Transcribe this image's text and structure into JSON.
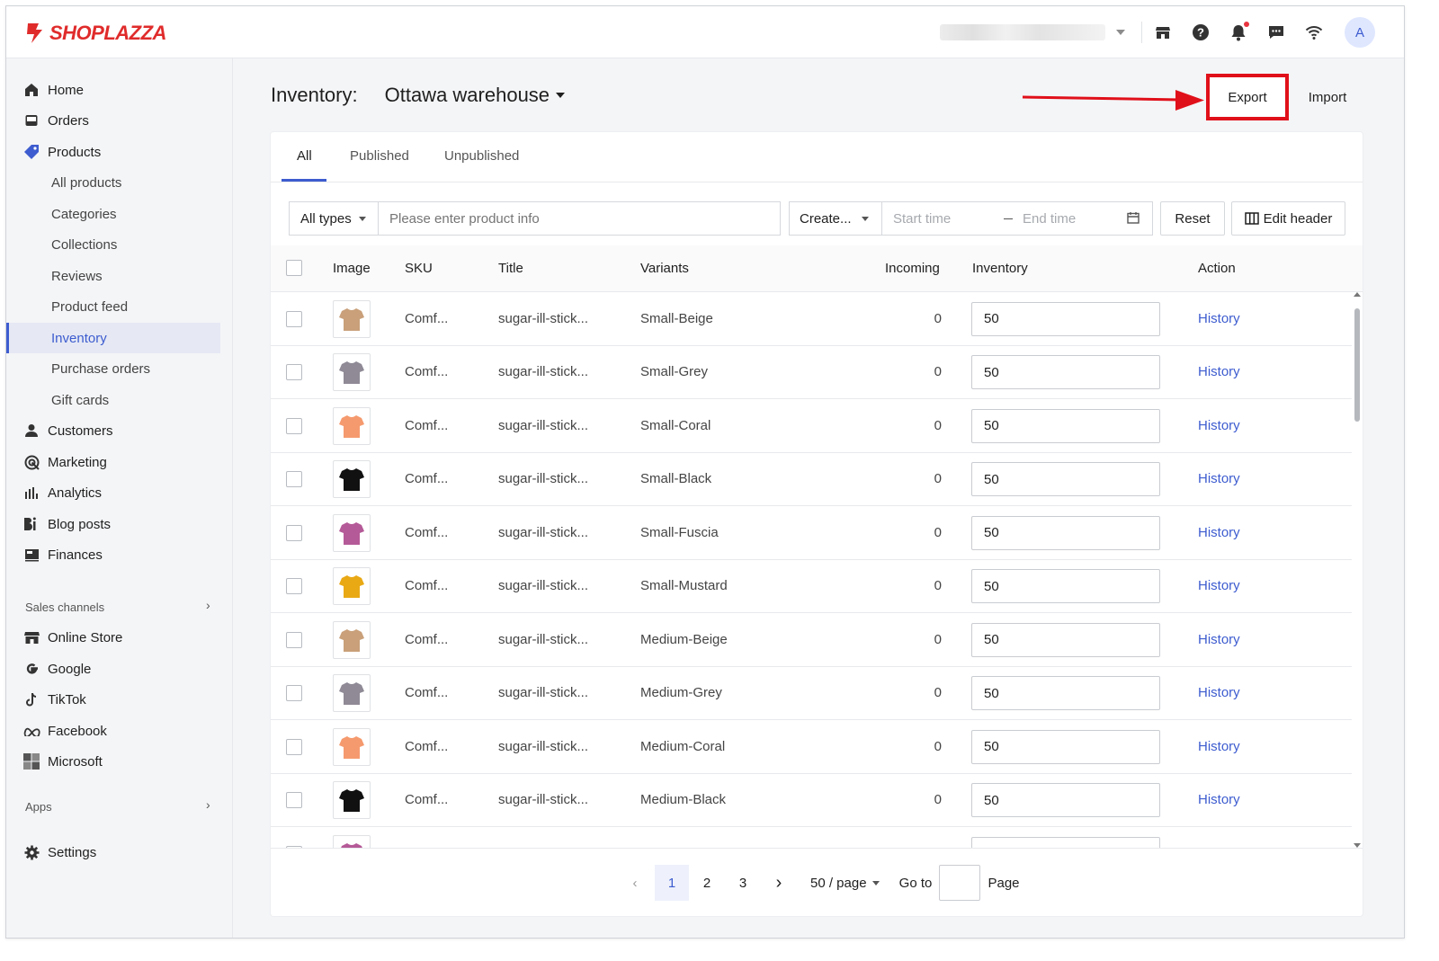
{
  "app": {
    "logo_text": "SHOPLAZZA",
    "avatar_initial": "A"
  },
  "topbar": {
    "icons": [
      "store-icon",
      "help-icon",
      "bell-icon",
      "chat-icon",
      "wifi-icon"
    ]
  },
  "sidebar": {
    "items": [
      {
        "label": "Home",
        "icon": "home-icon"
      },
      {
        "label": "Orders",
        "icon": "orders-icon"
      },
      {
        "label": "Products",
        "icon": "tag-icon"
      },
      {
        "label": "All products"
      },
      {
        "label": "Categories"
      },
      {
        "label": "Collections"
      },
      {
        "label": "Reviews"
      },
      {
        "label": "Product feed"
      },
      {
        "label": "Inventory",
        "active": true
      },
      {
        "label": "Purchase orders"
      },
      {
        "label": "Gift cards"
      },
      {
        "label": "Customers",
        "icon": "person-icon"
      },
      {
        "label": "Marketing",
        "icon": "marketing-icon"
      },
      {
        "label": "Analytics",
        "icon": "analytics-icon"
      },
      {
        "label": "Blog posts",
        "icon": "blog-icon"
      },
      {
        "label": "Finances",
        "icon": "finances-icon"
      }
    ],
    "sales_channels_label": "Sales channels",
    "channels": [
      {
        "label": "Online Store",
        "icon": "storefront-icon"
      },
      {
        "label": "Google",
        "icon": "google-icon"
      },
      {
        "label": "TikTok",
        "icon": "tiktok-icon"
      },
      {
        "label": "Facebook",
        "icon": "meta-icon"
      },
      {
        "label": "Microsoft",
        "icon": "microsoft-icon"
      }
    ],
    "apps_label": "Apps",
    "settings_label": "Settings"
  },
  "header": {
    "title": "Inventory:",
    "warehouse": "Ottawa warehouse",
    "export_label": "Export",
    "import_label": "Import"
  },
  "tabs": [
    "All",
    "Published",
    "Unpublished"
  ],
  "filters": {
    "type_select": "All types",
    "search_placeholder": "Please enter product info",
    "created_select": "Create...",
    "start_placeholder": "Start time",
    "end_placeholder": "End time",
    "reset_label": "Reset",
    "edit_header_label": "Edit header"
  },
  "table": {
    "headers": {
      "image": "Image",
      "sku": "SKU",
      "title": "Title",
      "variants": "Variants",
      "incoming": "Incoming",
      "inventory": "Inventory",
      "action": "Action"
    },
    "rows": [
      {
        "sku": "Comf...",
        "title": "sugar-ill-stick...",
        "variant": "Small-Beige",
        "incoming": "0",
        "inventory": "50",
        "action": "History",
        "color": "#c9a07a"
      },
      {
        "sku": "Comf...",
        "title": "sugar-ill-stick...",
        "variant": "Small-Grey",
        "incoming": "0",
        "inventory": "50",
        "action": "History",
        "color": "#8f8a96"
      },
      {
        "sku": "Comf...",
        "title": "sugar-ill-stick...",
        "variant": "Small-Coral",
        "incoming": "0",
        "inventory": "50",
        "action": "History",
        "color": "#f59a6e"
      },
      {
        "sku": "Comf...",
        "title": "sugar-ill-stick...",
        "variant": "Small-Black",
        "incoming": "0",
        "inventory": "50",
        "action": "History",
        "color": "#111111"
      },
      {
        "sku": "Comf...",
        "title": "sugar-ill-stick...",
        "variant": "Small-Fuscia",
        "incoming": "0",
        "inventory": "50",
        "action": "History",
        "color": "#b55a98"
      },
      {
        "sku": "Comf...",
        "title": "sugar-ill-stick...",
        "variant": "Small-Mustard",
        "incoming": "0",
        "inventory": "50",
        "action": "History",
        "color": "#e9a915"
      },
      {
        "sku": "Comf...",
        "title": "sugar-ill-stick...",
        "variant": "Medium-Beige",
        "incoming": "0",
        "inventory": "50",
        "action": "History",
        "color": "#c9a07a"
      },
      {
        "sku": "Comf...",
        "title": "sugar-ill-stick...",
        "variant": "Medium-Grey",
        "incoming": "0",
        "inventory": "50",
        "action": "History",
        "color": "#8f8a96"
      },
      {
        "sku": "Comf...",
        "title": "sugar-ill-stick...",
        "variant": "Medium-Coral",
        "incoming": "0",
        "inventory": "50",
        "action": "History",
        "color": "#f59a6e"
      },
      {
        "sku": "Comf...",
        "title": "sugar-ill-stick...",
        "variant": "Medium-Black",
        "incoming": "0",
        "inventory": "50",
        "action": "History",
        "color": "#111111"
      },
      {
        "sku": "",
        "title": "",
        "variant": "",
        "incoming": "",
        "inventory": "",
        "action": "",
        "color": "#b55a98"
      }
    ]
  },
  "pagination": {
    "pages": [
      "1",
      "2",
      "3"
    ],
    "current": "1",
    "per_page": "50 / page",
    "goto_label": "Go to",
    "page_label": "Page"
  },
  "colors": {
    "accent": "#3d5ccf",
    "highlight": "#e0101a",
    "brand": "#e02b2b"
  }
}
